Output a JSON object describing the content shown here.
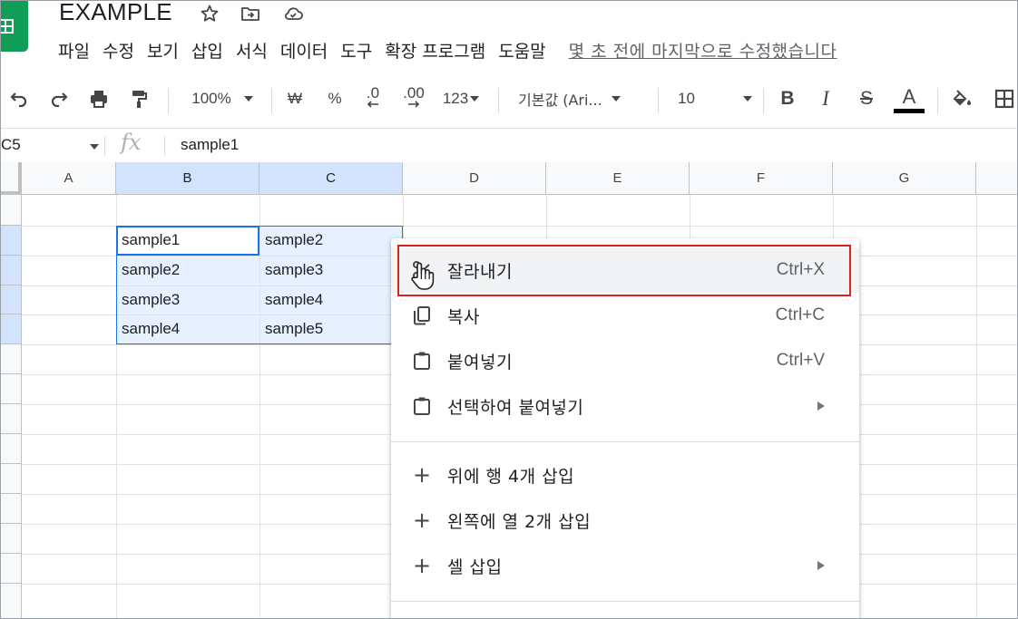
{
  "app": {
    "title": "EXAMPLE",
    "last_edit": "몇 초 전에 마지막으로 수정했습니다"
  },
  "menu": [
    "파일",
    "수정",
    "보기",
    "삽입",
    "서식",
    "데이터",
    "도구",
    "확장 프로그램",
    "도움말"
  ],
  "toolbar": {
    "zoom": "100%",
    "currency": "₩",
    "percent": "%",
    "dec_decrease": ".0",
    "dec_increase": ".00",
    "more_formats": "123",
    "font": "기본값 (Ari...",
    "font_size": "10",
    "bold": "B",
    "italic": "I",
    "strike": "S",
    "text_color": "A"
  },
  "formula_bar": {
    "name_box": "C5",
    "fx": "fx",
    "value": "sample1"
  },
  "columns": [
    "A",
    "B",
    "C",
    "D",
    "E",
    "F",
    "G"
  ],
  "cells": {
    "B": [
      "sample1",
      "sample2",
      "sample3",
      "sample4"
    ],
    "C": [
      "sample2",
      "sample3",
      "sample4",
      "sample5"
    ]
  },
  "context_menu": {
    "cut": {
      "label": "잘라내기",
      "shortcut": "Ctrl+X"
    },
    "copy": {
      "label": "복사",
      "shortcut": "Ctrl+C"
    },
    "paste": {
      "label": "붙여넣기",
      "shortcut": "Ctrl+V"
    },
    "paste_special": {
      "label": "선택하여 붙여넣기"
    },
    "insert_rows": {
      "label": "위에 행 4개 삽입"
    },
    "insert_cols": {
      "label": "왼쪽에 열 2개 삽입"
    },
    "insert_cells": {
      "label": "셀 삽입"
    }
  },
  "colors": {
    "highlight_border": "#d9221c",
    "selection": "#1a73e8",
    "brand": "#0f9d58"
  }
}
